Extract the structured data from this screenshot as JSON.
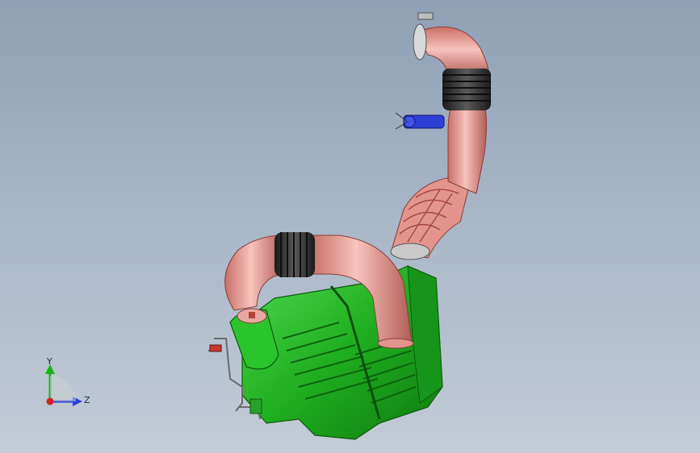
{
  "viewport": {
    "background_top": "#8fa0b5",
    "background_bottom": "#c3ccd7"
  },
  "model": {
    "colors": {
      "housing": "#22b522",
      "housing_dark": "#137a13",
      "duct": "#e79b93",
      "duct_dark": "#b25d57",
      "bellows": "#2a2a2a",
      "bracket": "#2e3fd6"
    }
  },
  "triad": {
    "y_label": "Y",
    "z_label": "Z",
    "y_color": "#1bb31b",
    "z_color": "#2640d8",
    "x_color": "#d42020"
  }
}
